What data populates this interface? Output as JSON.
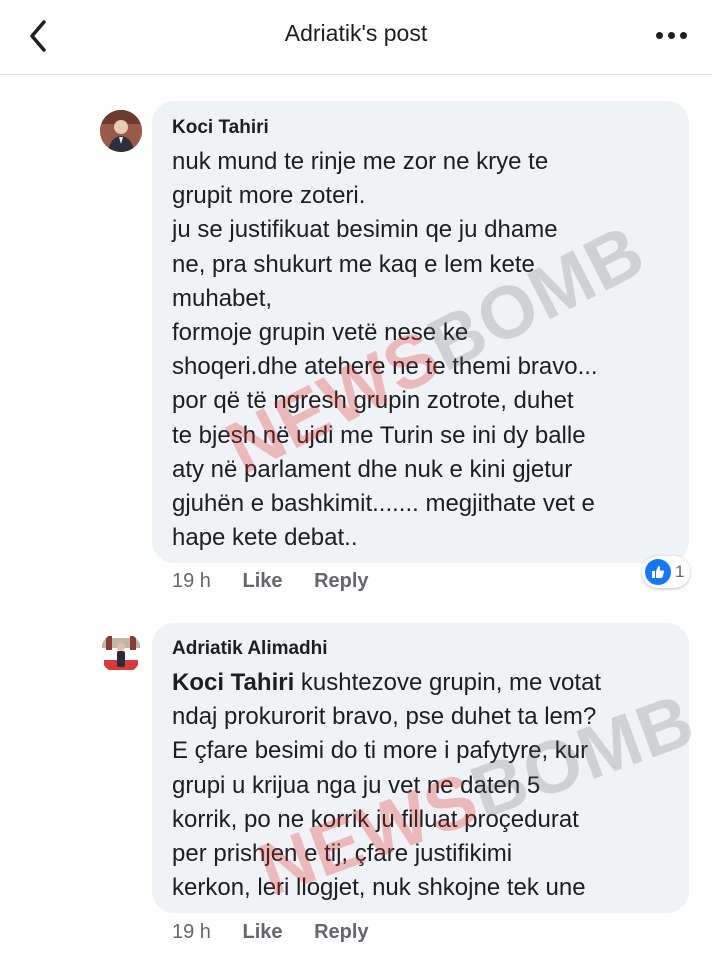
{
  "header": {
    "title": "Adriatik's post",
    "back_icon": "chevron-left-icon",
    "more_icon": "more-horizontal-icon"
  },
  "comments": [
    {
      "author": "Koci Tahiri",
      "lines": [
        "nuk mund te rinje  me zor ne krye te",
        "grupit more zoteri.",
        "ju se justifikuat besimin qe ju dhame",
        "ne, pra shukurt me kaq e lem kete",
        "muhabet,",
        "formoje grupin vetë nese ke",
        "shoqeri.dhe atehere ne te themi bravo...",
        "por që të ngresh grupin zotrote, duhet",
        "te bjesh në ujdi me Turin se ini dy balle",
        "aty në parlament dhe nuk e kini gjetur",
        "gjuhën e bashkimit....... megjithate vet e",
        "hape kete debat.."
      ],
      "time": "19 h",
      "like_label": "Like",
      "reply_label": "Reply",
      "reaction_count": "1",
      "reaction_icon": "like-icon"
    },
    {
      "author": "Adriatik Alimadhi",
      "mention": "Koci Tahiri",
      "first_line_rest": " kushtezove grupin, me votat",
      "lines": [
        "ndaj prokurorit bravo, pse duhet ta lem?",
        "E çfare besimi do ti more i pafytyre, kur",
        "grupi u krijua nga ju vet ne daten 5",
        "korrik, po ne korrik ju filluat proçedurat",
        "per prishjen e tij, çfare justifikimi",
        "kerkon, leri llogjet, nuk shkojne tek une"
      ],
      "time": "19 h",
      "like_label": "Like",
      "reply_label": "Reply"
    }
  ],
  "watermark": {
    "part1": "NEWS",
    "part2": "BOMB"
  },
  "colors": {
    "bubble": "#f0f2f5",
    "meta": "#65676b",
    "like_blue": "#1877f2"
  }
}
